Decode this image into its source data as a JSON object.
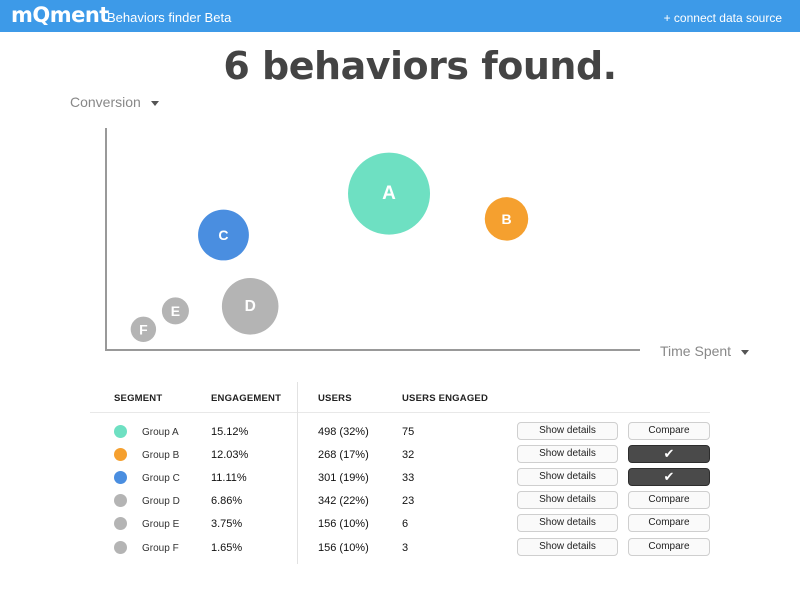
{
  "header": {
    "logo": "mQment",
    "app_title": "Behaviors finder Beta",
    "connect_link": "+ connect data source"
  },
  "headline": "6 behaviors found.",
  "axes": {
    "y_label": "Conversion",
    "x_label": "Time Spent"
  },
  "colors": {
    "topbar": "#3d9ae8",
    "teal": "#6ee0c2",
    "orange": "#f5a02f",
    "blue": "#4a8ee0",
    "gray": "#b4b4b4"
  },
  "chart_data": {
    "type": "scatter",
    "title": "",
    "xlabel": "Time Spent",
    "ylabel": "Conversion",
    "grid": false,
    "points": [
      {
        "label": "A",
        "x": 0.53,
        "y": 0.68,
        "size": 1.0,
        "color": "#6ee0c2"
      },
      {
        "label": "B",
        "x": 0.75,
        "y": 0.57,
        "size": 0.53,
        "color": "#f5a02f"
      },
      {
        "label": "C",
        "x": 0.22,
        "y": 0.5,
        "size": 0.62,
        "color": "#4a8ee0"
      },
      {
        "label": "D",
        "x": 0.27,
        "y": 0.19,
        "size": 0.69,
        "color": "#b4b4b4"
      },
      {
        "label": "E",
        "x": 0.13,
        "y": 0.17,
        "size": 0.33,
        "color": "#b4b4b4"
      },
      {
        "label": "F",
        "x": 0.07,
        "y": 0.09,
        "size": 0.31,
        "color": "#b4b4b4"
      }
    ]
  },
  "table": {
    "headers": {
      "segment": "SEGMENT",
      "engagement": "ENGAGEMENT",
      "users": "USERS",
      "users_engaged": "USERS ENGAGED"
    },
    "details_label": "Show details",
    "compare_label": "Compare",
    "check_glyph": "✔",
    "rows": [
      {
        "name": "Group A",
        "engagement": "15.12%",
        "users": "498 (32%)",
        "users_engaged": "75",
        "color": "#6ee0c2",
        "compare_active": false
      },
      {
        "name": "Group B",
        "engagement": "12.03%",
        "users": "268 (17%)",
        "users_engaged": "32",
        "color": "#f5a02f",
        "compare_active": true
      },
      {
        "name": "Group C",
        "engagement": "11.11%",
        "users": "301 (19%)",
        "users_engaged": "33",
        "color": "#4a8ee0",
        "compare_active": true
      },
      {
        "name": "Group D",
        "engagement": "6.86%",
        "users": "342 (22%)",
        "users_engaged": "23",
        "color": "#b4b4b4",
        "compare_active": false
      },
      {
        "name": "Group E",
        "engagement": "3.75%",
        "users": "156 (10%)",
        "users_engaged": "6",
        "color": "#b4b4b4",
        "compare_active": false
      },
      {
        "name": "Group F",
        "engagement": "1.65%",
        "users": "156 (10%)",
        "users_engaged": "3",
        "color": "#b4b4b4",
        "compare_active": false
      }
    ]
  }
}
